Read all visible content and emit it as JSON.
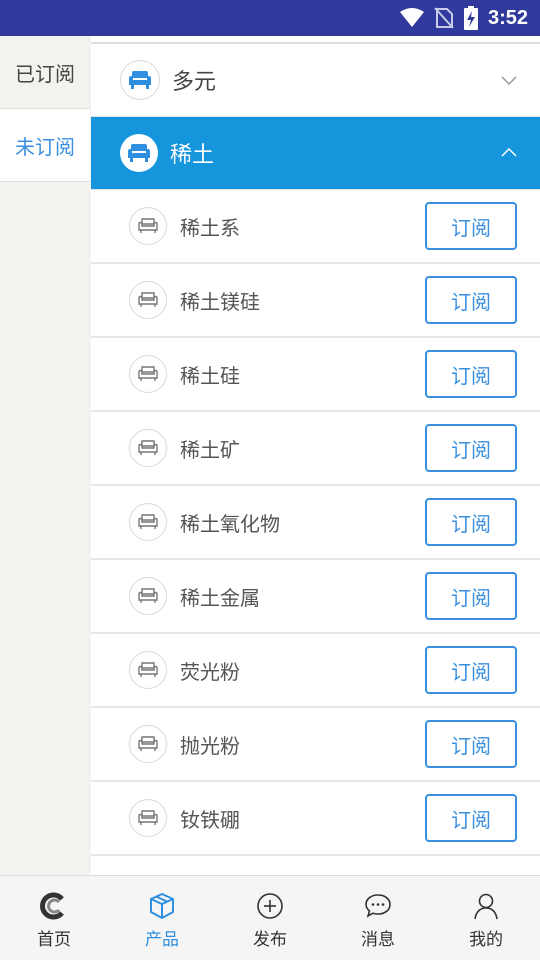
{
  "status_bar": {
    "time": "3:52"
  },
  "side_tabs": [
    {
      "label": "已订阅",
      "active": false
    },
    {
      "label": "未订阅",
      "active": true
    }
  ],
  "categories": [
    {
      "label": "多元",
      "expanded": false
    },
    {
      "label": "稀土",
      "expanded": true
    }
  ],
  "subitems": [
    {
      "label": "稀土系",
      "button": "订阅"
    },
    {
      "label": "稀土镁硅",
      "button": "订阅"
    },
    {
      "label": "稀土硅",
      "button": "订阅"
    },
    {
      "label": "稀土矿",
      "button": "订阅"
    },
    {
      "label": "稀土氧化物",
      "button": "订阅"
    },
    {
      "label": "稀土金属",
      "button": "订阅"
    },
    {
      "label": "荧光粉",
      "button": "订阅"
    },
    {
      "label": "抛光粉",
      "button": "订阅"
    },
    {
      "label": "钕铁硼",
      "button": "订阅"
    }
  ],
  "bottom_nav": [
    {
      "label": "首页",
      "icon": "home-logo-icon",
      "active": false
    },
    {
      "label": "产品",
      "icon": "box-icon",
      "active": true
    },
    {
      "label": "发布",
      "icon": "plus-circle-icon",
      "active": false
    },
    {
      "label": "消息",
      "icon": "chat-bubble-icon",
      "active": false
    },
    {
      "label": "我的",
      "icon": "user-icon",
      "active": false
    }
  ],
  "colors": {
    "accent": "#1595db",
    "status_bar": "#303a9c",
    "active_text": "#3a8fe0"
  }
}
